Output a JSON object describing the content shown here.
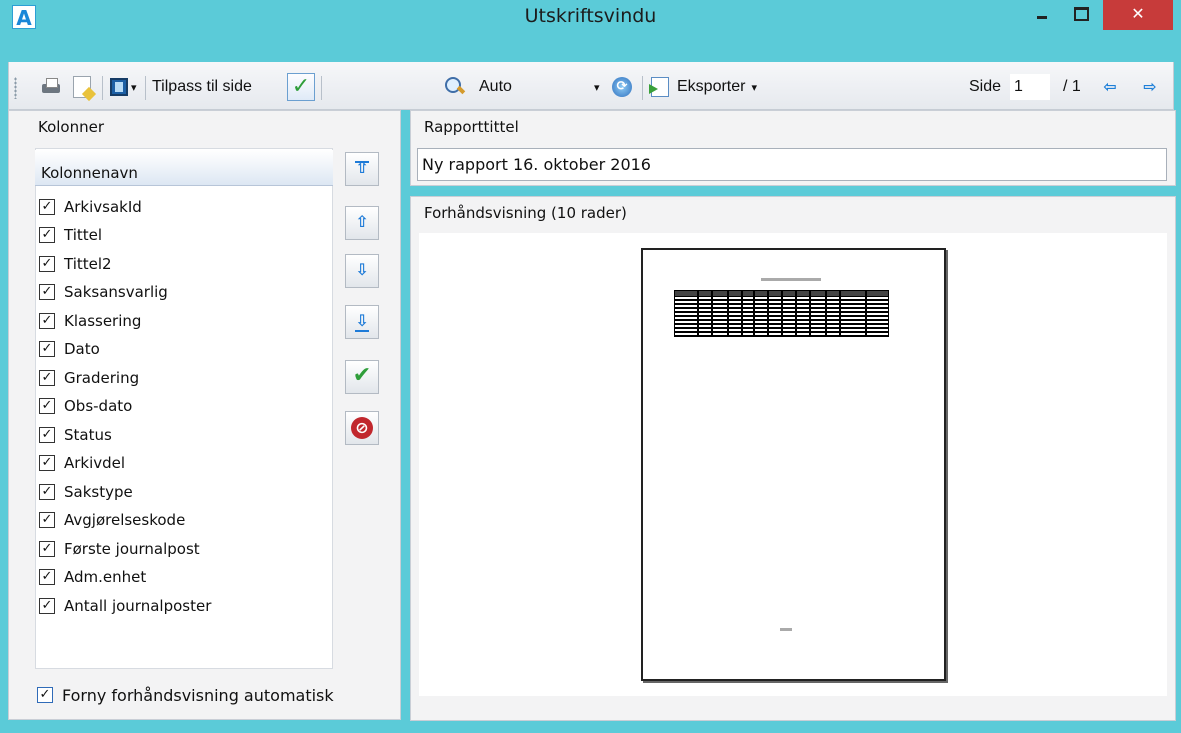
{
  "window": {
    "app_icon": "A",
    "title": "Utskriftsvindu",
    "close_glyph": "✕"
  },
  "toolbar": {
    "fit_label": "Tilpass til side",
    "fit_check": "✓",
    "zoom_value": "Auto",
    "zoom_caret": "▾",
    "export_label": "Eksporter",
    "export_caret": "▾",
    "page_label": "Side",
    "page_value": "1",
    "page_total": "/ 1",
    "prev_glyph": "⇦",
    "next_glyph": "⇨",
    "layout_caret": "▾",
    "refresh_glyph": "⟳"
  },
  "columns_panel": {
    "title": "Kolonner",
    "header": "Kolonnenavn",
    "items": [
      {
        "label": "ArkivsakId",
        "checked": "✓"
      },
      {
        "label": "Tittel",
        "checked": "✓"
      },
      {
        "label": "Tittel2",
        "checked": "✓"
      },
      {
        "label": "Saksansvarlig",
        "checked": "✓"
      },
      {
        "label": "Klassering",
        "checked": "✓"
      },
      {
        "label": "Dato",
        "checked": "✓"
      },
      {
        "label": "Gradering",
        "checked": "✓"
      },
      {
        "label": "Obs-dato",
        "checked": "✓"
      },
      {
        "label": "Status",
        "checked": "✓"
      },
      {
        "label": "Arkivdel",
        "checked": "✓"
      },
      {
        "label": "Sakstype",
        "checked": "✓"
      },
      {
        "label": "Avgjørelseskode",
        "checked": "✓"
      },
      {
        "label": "Første journalpost",
        "checked": "✓"
      },
      {
        "label": "Adm.enhet",
        "checked": "✓"
      },
      {
        "label": "Antall journalposter",
        "checked": "✓"
      }
    ],
    "buttons": {
      "move_top": "⇧",
      "move_up": "⇧",
      "move_down": "⇩",
      "move_bottom": "⇩",
      "apply": "✔",
      "cancel": "⊘"
    },
    "auto_refresh_label": "Forny forhåndsvisning automatisk",
    "auto_refresh_checked": "✓"
  },
  "report_panel": {
    "title": "Rapporttittel",
    "value": "Ny rapport 16. oktober 2016"
  },
  "preview_panel": {
    "title": "Forhåndsvisning (10 rader)"
  },
  "icons": [
    "printer-icon",
    "page-setup-icon",
    "layout-icon",
    "zoom-icon",
    "refresh-icon",
    "export-icon",
    "prev-page-icon",
    "next-page-icon"
  ],
  "colors": {
    "titlebar": "#5bcbd8",
    "close": "#c73b3a",
    "accent": "#1e7bd8"
  }
}
